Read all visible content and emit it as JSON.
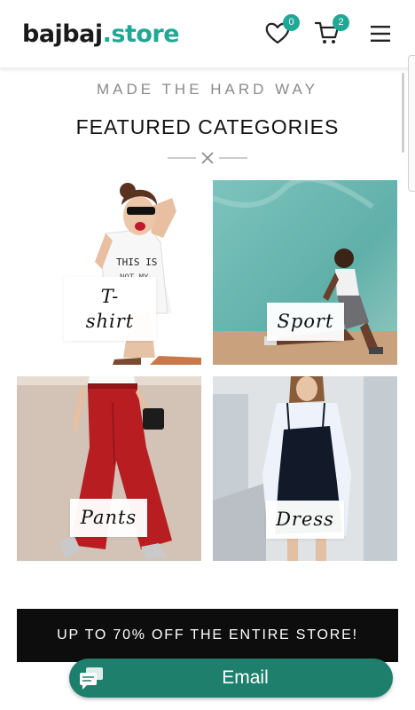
{
  "header": {
    "logo": {
      "brand": "bajbaj",
      "dot": ".",
      "tld": "store"
    },
    "wishlist": {
      "icon": "heart-icon",
      "count": "0"
    },
    "cart": {
      "icon": "cart-icon",
      "count": "2"
    },
    "menu": {
      "icon": "hamburger-menu-icon"
    }
  },
  "hero": {
    "tagline": "MADE THE HARD WAY",
    "title": "FEATURED CATEGORIES",
    "divider_icon": "x-icon"
  },
  "categories": [
    {
      "label_line1": "T-",
      "label_line2": "shirt"
    },
    {
      "label": "Sport"
    },
    {
      "label": "Pants"
    },
    {
      "label": "Dress"
    }
  ],
  "promo": {
    "text": "UP TO 70% OFF THE ENTIRE STORE!"
  },
  "email_button": {
    "label": "Email",
    "icon": "chat-icon"
  },
  "colors": {
    "accent": "#1fa896",
    "email_bg": "#1e7f6c",
    "promo_bg": "#0d0d0d"
  }
}
